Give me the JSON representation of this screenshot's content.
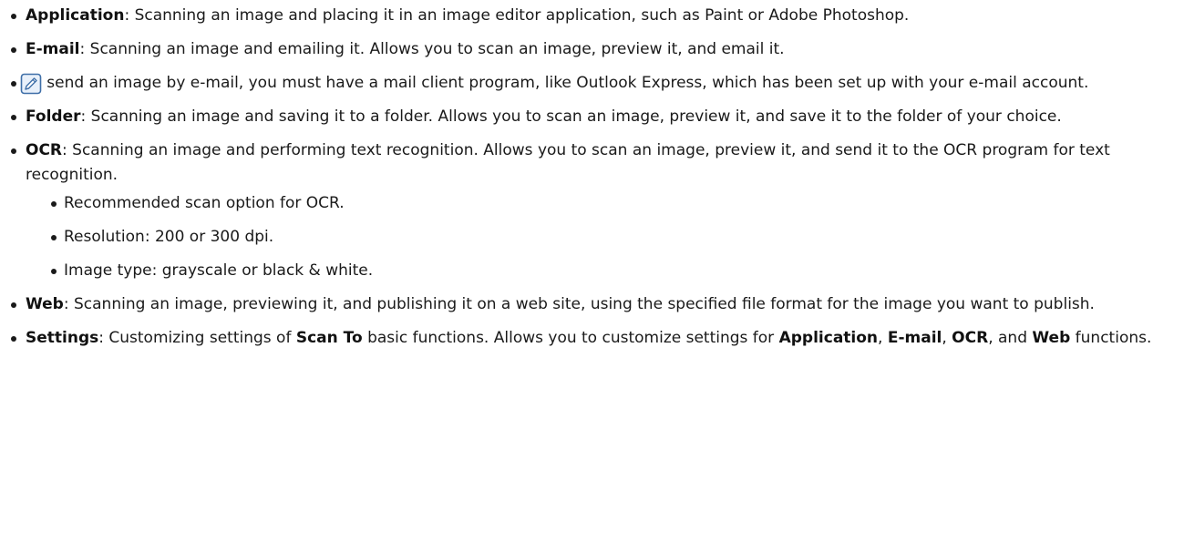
{
  "items": [
    {
      "term": "Application",
      "text": ": Scanning an image and placing it in an image editor application, such as Paint or Adobe Photoshop."
    },
    {
      "term": "E-mail",
      "text": ": Scanning an image and emailing it. Allows you to scan an image, preview it, and email it."
    },
    {
      "term": "Folder",
      "text": ": Scanning an image and saving it to a folder. Allows you to scan an image, preview it, and save it to the folder of your choice."
    },
    {
      "term": "OCR",
      "text": ": Scanning an image and performing text recognition. Allows you to scan an image, preview it, and send it to the OCR program for text recognition."
    },
    {
      "term": "Web",
      "text": ": Scanning an image, previewing it, and publishing it on a web site, using the specified file format for the image you want to publish."
    }
  ],
  "note": {
    "icon": "note-pencil-icon",
    "text": "To send an image by e-mail, you must have a mail client program, like Outlook Express, which has been set up with your e-mail account."
  },
  "ocr_subitems": [
    "Recommended scan option for OCR.",
    "Resolution: 200 or 300 dpi.",
    "Image type: grayscale or black & white."
  ],
  "settings": {
    "term": "Settings",
    "text1": ": Customizing settings of ",
    "scan_to": "Scan To",
    "text2": " basic functions. Allows you to customize settings for ",
    "app": "Application",
    "comma1": ", ",
    "email": "E-mail",
    "comma2": ", ",
    "ocr": "OCR",
    "and": ", and ",
    "web": "Web",
    "end": " functions."
  },
  "colors": {
    "text": "#1a1a1a",
    "note_icon_stroke": "#3f6fa8",
    "note_icon_fill": "#e8f0fa"
  }
}
